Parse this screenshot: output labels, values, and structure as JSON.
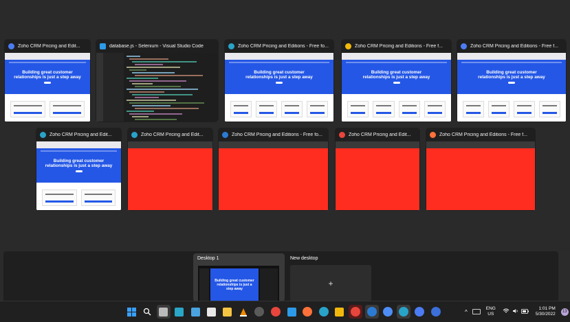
{
  "windows_row1": [
    {
      "title": "Zoho CRM Pricing and Edit...",
      "icon": "chrome-icon",
      "icon_color": "#4c7cf3",
      "content": "zoho-page"
    },
    {
      "title": "database.js - Selenium - Visual Studio Code",
      "icon": "vscode-icon",
      "icon_color": "#2c9ae8",
      "content": "code-editor"
    },
    {
      "title": "Zoho CRM Pricing and Editions - Free fo...",
      "icon": "edge-icon",
      "icon_color": "#29a3c8",
      "content": "zoho-page"
    },
    {
      "title": "Zoho CRM Pricing and Editions - Free f...",
      "icon": "chrome-canary-icon",
      "icon_color": "#f2b90c",
      "content": "zoho-page"
    },
    {
      "title": "Zoho CRM Pricing and Editions - Free f...",
      "icon": "chrome-icon",
      "icon_color": "#4c7cf3",
      "content": "zoho-page"
    }
  ],
  "windows_row2": [
    {
      "title": "Zoho CRM Pricing and Edit...",
      "icon": "edge-icon",
      "icon_color": "#29a3c8",
      "content": "zoho-page"
    },
    {
      "title": "Zoho CRM Pricing and Edit...",
      "icon": "edge-icon",
      "icon_color": "#29a3c8",
      "content": "red"
    },
    {
      "title": "Zoho CRM Pricing and Editions - Free fo...",
      "icon": "edge-dev-icon",
      "icon_color": "#2b7bd3",
      "content": "red"
    },
    {
      "title": "Zoho CRM Pricing and Edit...",
      "icon": "chrome-icon",
      "icon_color": "#e8453c",
      "content": "red"
    },
    {
      "title": "Zoho CRM Pricing and Editions - Free f...",
      "icon": "firefox-icon",
      "icon_color": "#ff7139",
      "content": "red"
    }
  ],
  "page_preview": {
    "headline": "Building great customer relationships is just a step away"
  },
  "desktops": {
    "current": "Desktop 1",
    "new": "New desktop",
    "plus": "+"
  },
  "taskbar": {
    "icons": [
      "start-icon",
      "search-icon",
      "task-view-icon",
      "app-l-icon",
      "widgets-icon",
      "store-icon",
      "explorer-icon",
      "vlc-icon",
      "media-player-icon",
      "chrome-icon",
      "vscode-icon",
      "firefox-icon",
      "edge-icon",
      "chrome-canary-icon",
      "chrome-active-icon",
      "edge-dev-icon",
      "edge-beta-icon",
      "edge-icon-2",
      "chrome-icon-2",
      "chrome-icon-3"
    ],
    "language": "ENG",
    "region": "US",
    "time": "1:01 PM",
    "date": "5/30/2022",
    "notification_count": "13",
    "chevron": "^"
  },
  "colors": {
    "accent_blue": "#2457e6",
    "red_fill": "#fe2d1f"
  }
}
